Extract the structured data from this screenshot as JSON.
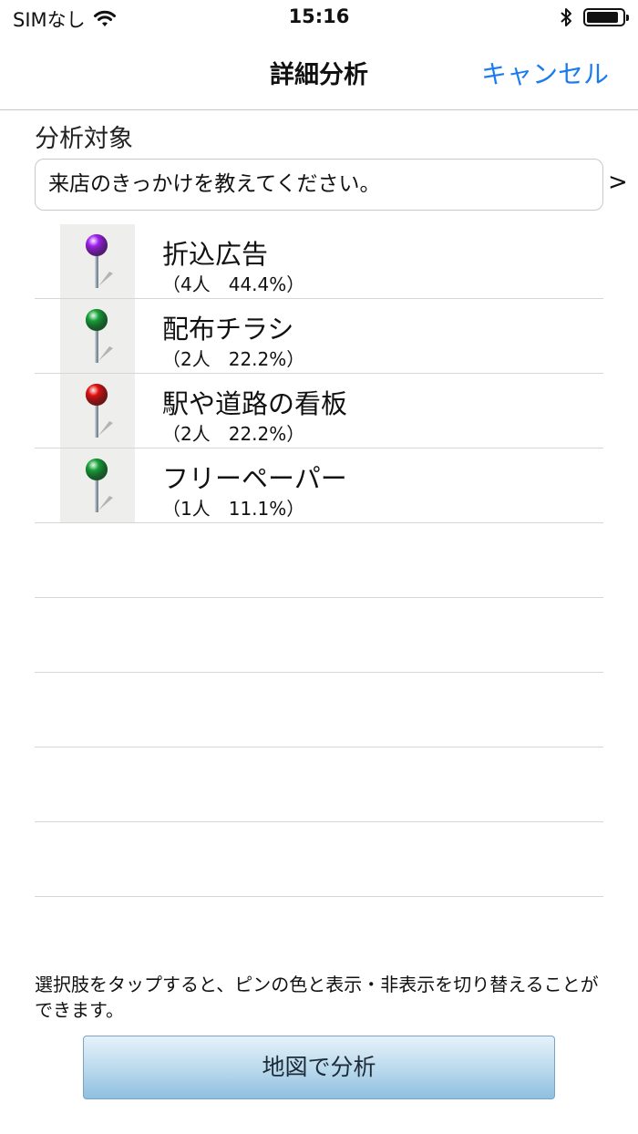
{
  "status_bar": {
    "carrier": "SIMなし",
    "time": "15:16",
    "battery_level": 0.9
  },
  "nav": {
    "title": "詳細分析",
    "cancel_label": "キャンセル"
  },
  "target": {
    "label": "分析対象",
    "value": "来店のきっかけを教えてください。",
    "arrow": ">"
  },
  "items": [
    {
      "title": "折込広告",
      "sub": "（4人　44.4%）",
      "pin_color": "#a020f0"
    },
    {
      "title": "配布チラシ",
      "sub": "（2人　22.2%）",
      "pin_color": "#16a33a"
    },
    {
      "title": "駅や道路の看板",
      "sub": "（2人　22.2%）",
      "pin_color": "#e01010"
    },
    {
      "title": "フリーペーパー",
      "sub": "（1人　11.1%）",
      "pin_color": "#16a33a"
    }
  ],
  "hint": "選択肢をタップすると、ピンの色と表示・非表示を切り替えることができます。",
  "analyze_button": "地図で分析"
}
